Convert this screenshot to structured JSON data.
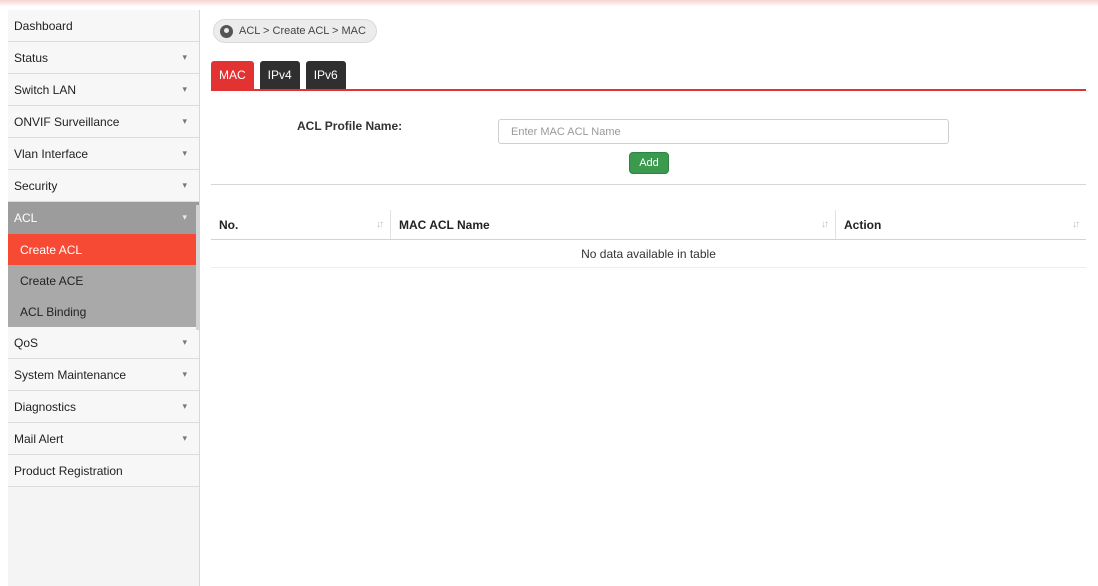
{
  "sidebar": {
    "items": [
      {
        "label": "Dashboard",
        "caret": ""
      },
      {
        "label": "Status",
        "caret": "▾"
      },
      {
        "label": "Switch LAN",
        "caret": "▾"
      },
      {
        "label": "ONVIF Surveillance",
        "caret": "▾"
      },
      {
        "label": "Vlan Interface",
        "caret": "▾"
      },
      {
        "label": "Security",
        "caret": "▾"
      },
      {
        "label": "ACL",
        "caret": "▾"
      },
      {
        "label": "QoS",
        "caret": "▾"
      },
      {
        "label": "System Maintenance",
        "caret": "▾"
      },
      {
        "label": "Diagnostics",
        "caret": "▾"
      },
      {
        "label": "Mail Alert",
        "caret": "▾"
      },
      {
        "label": "Product Registration",
        "caret": ""
      }
    ],
    "acl_submenu": [
      "Create ACL",
      "Create ACE",
      "ACL Binding"
    ]
  },
  "breadcrumb": {
    "icon": "location-pin-icon",
    "text": "ACL > Create ACL  > MAC"
  },
  "tabs": [
    "MAC",
    "IPv4",
    "IPv6"
  ],
  "form": {
    "label": "ACL Profile Name:",
    "placeholder": "Enter MAC ACL Name",
    "value": "",
    "add_label": "Add"
  },
  "table": {
    "columns": [
      "No.",
      "MAC ACL Name",
      "Action"
    ],
    "sort_icon": "sort-arrows-icon",
    "empty_text": "No data available in table"
  },
  "colors": {
    "accent": "#e33232",
    "active_submenu": "#f64a35",
    "tab_dark": "#2f2f2f",
    "add_button": "#3b9a4e",
    "sidebar_active": "#9c9c9c"
  }
}
